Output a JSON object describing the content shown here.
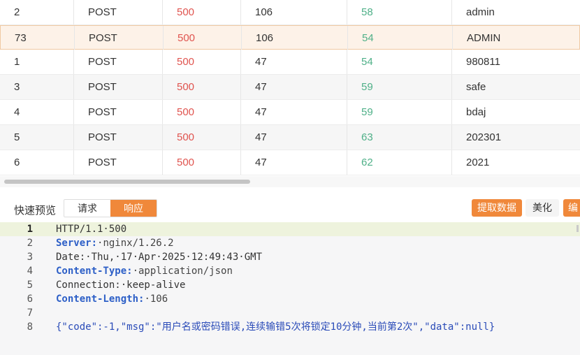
{
  "table": {
    "rows": [
      {
        "id": "2",
        "method": "POST",
        "status": "500",
        "length": "106",
        "time": "58",
        "payload": "admin"
      },
      {
        "id": "73",
        "method": "POST",
        "status": "500",
        "length": "106",
        "time": "54",
        "payload": "ADMIN"
      },
      {
        "id": "1",
        "method": "POST",
        "status": "500",
        "length": "47",
        "time": "54",
        "payload": "980811"
      },
      {
        "id": "3",
        "method": "POST",
        "status": "500",
        "length": "47",
        "time": "59",
        "payload": "safe"
      },
      {
        "id": "4",
        "method": "POST",
        "status": "500",
        "length": "47",
        "time": "59",
        "payload": "bdaj"
      },
      {
        "id": "5",
        "method": "POST",
        "status": "500",
        "length": "47",
        "time": "63",
        "payload": "202301"
      },
      {
        "id": "6",
        "method": "POST",
        "status": "500",
        "length": "47",
        "time": "62",
        "payload": "2021"
      }
    ],
    "selected_row_index": 1
  },
  "preview": {
    "title": "快速预览",
    "tabs": {
      "request": "请求",
      "response": "响应"
    },
    "active_tab": "response",
    "extract_button": "提取数据",
    "beautify_button": "美化",
    "edit_button": "编"
  },
  "response": {
    "current_line": 1,
    "lines": [
      {
        "n": "1",
        "status_line": "HTTP/1.1·500"
      },
      {
        "n": "2",
        "key": "Server:",
        "value": "·nginx/1.26.2"
      },
      {
        "n": "3",
        "plain": "Date:·Thu,·17·Apr·2025·12:49:43·GMT"
      },
      {
        "n": "4",
        "key": "Content-Type:",
        "value": "·application/json"
      },
      {
        "n": "5",
        "plain": "Connection:·keep-alive"
      },
      {
        "n": "6",
        "key": "Content-Length:",
        "value": "·106"
      },
      {
        "n": "7"
      },
      {
        "n": "8",
        "body": "{\"code\":-1,\"msg\":\"用户名或密码错误,连续输错5次将锁定10分钟,当前第2次\",\"data\":null}"
      }
    ]
  },
  "colors": {
    "accent": "#f0883a",
    "status_error": "#e0544f",
    "time_green": "#4fb088",
    "header_key_blue": "#2d5fc7"
  }
}
